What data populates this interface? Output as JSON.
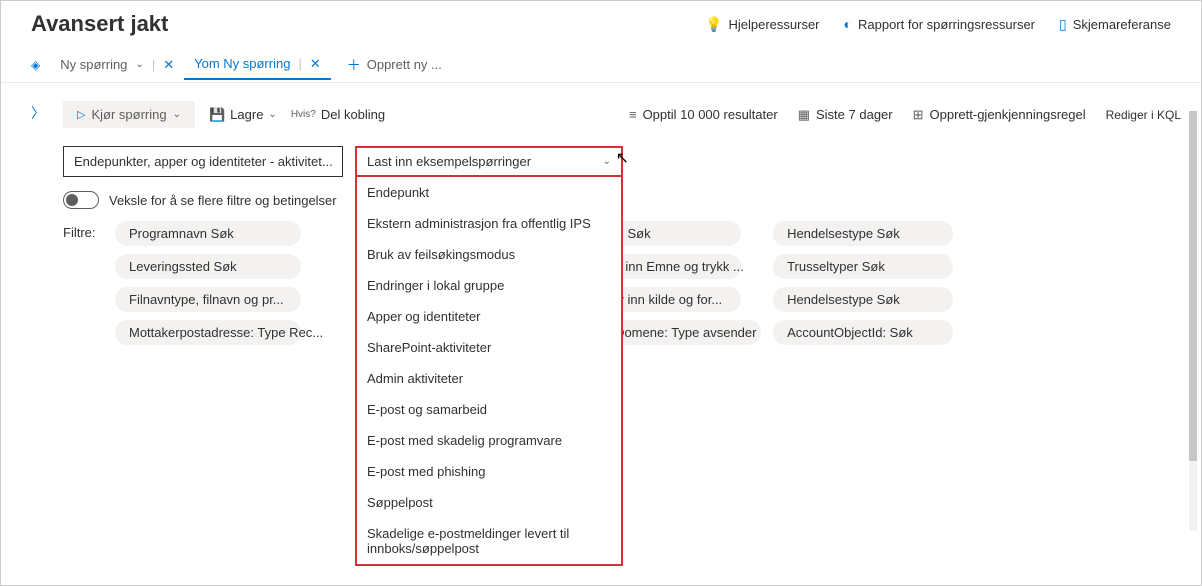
{
  "header": {
    "title": "Avansert jakt",
    "links": {
      "help": "Hjelperessurser",
      "report": "Rapport for spørringsressurser",
      "schema": "Skjemareferanse"
    }
  },
  "tabs": {
    "tab1": "Ny spørring",
    "tab2": "Yom Ny spørring",
    "new": "Opprett ny ..."
  },
  "toolbar": {
    "run": "Kjør spørring",
    "save": "Lagre",
    "share": "Del kobling",
    "share_badge": "Hvis?",
    "results": "Opptil 10 000 resultater",
    "timerange": "Siste 7 dager",
    "create_rule": "Opprett-gjenkjenningsregel",
    "edit_kql": "Rediger i KQL"
  },
  "filter_input": "Endepunkter, apper og identiteter - aktivitet...",
  "dropdown": {
    "trigger": "Last inn eksempelspørringer",
    "items": [
      "Endepunkt",
      "Ekstern administrasjon fra offentlig IPS",
      "Bruk av feilsøkingsmodus",
      "Endringer i lokal gruppe",
      "Apper og identiteter",
      "SharePoint-aktiviteter",
      "Admin aktiviteter",
      "E-post og samarbeid",
      "E-post med skadelig programvare",
      "E-post med phishing",
      "Søppelpost",
      "Skadelige e-postmeldinger levert til innboks/søppelpost"
    ]
  },
  "toggle_label": "Veksle for å se flere filtre og betingelser",
  "filters_label": "Filtre:",
  "pills": {
    "col1": [
      "Programnavn Søk",
      "Leveringssted Søk",
      "Filnavntype, filnavn og pr...",
      "Mottakerpostadresse: Type Rec..."
    ],
    "col2_suffix": [
      "meg: Søk",
      "skriv inn Emne og trykk ...",
      "Skriv inn kilde og for...",
      "Domene: Type avsender"
    ],
    "col2_prefix": [
      "",
      "",
      "",
      "om"
    ],
    "col3": [
      "Hendelsestype Søk",
      "Trusseltyper Søk",
      "Hendelsestype Søk",
      "AccountObjectId: Søk"
    ]
  }
}
